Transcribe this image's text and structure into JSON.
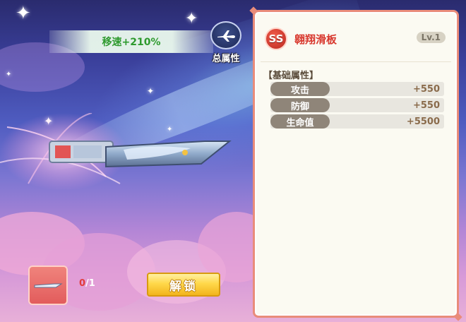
{
  "banner": {
    "stat_text": "移速+210%"
  },
  "total_button": {
    "label": "总属性",
    "icon": "airplane-icon"
  },
  "item": {
    "have": "0",
    "need": "/1",
    "unlock_label": "解锁"
  },
  "panel": {
    "rarity": "SS",
    "name": "翱翔滑板",
    "level": "Lv.1",
    "section_title": "【基础属性】",
    "attributes": [
      {
        "name": "攻击",
        "value": "+550"
      },
      {
        "name": "防御",
        "value": "+550"
      },
      {
        "name": "生命值",
        "value": "+5500"
      }
    ]
  },
  "colors": {
    "accent_red": "#d8382e",
    "panel_border": "#e98c7a",
    "stat_green": "#2e9a2e",
    "button_gold": "#f2b41d"
  }
}
